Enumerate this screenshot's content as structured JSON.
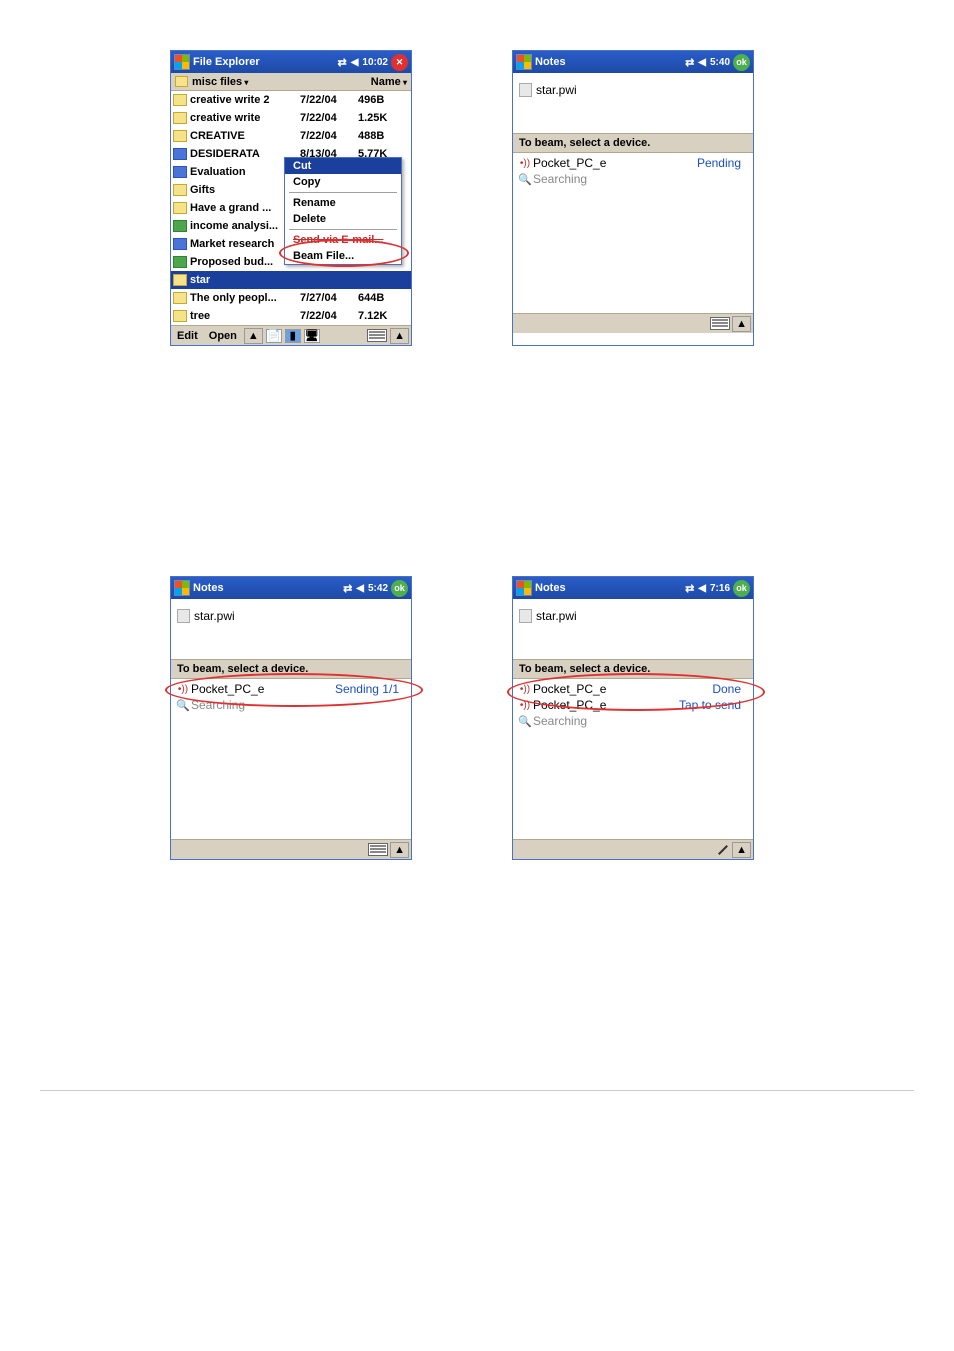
{
  "s1": {
    "title": "File Explorer",
    "time": "10:02",
    "subbar": {
      "folder": "misc files",
      "sort": "Name"
    },
    "files": [
      {
        "icon": "folder",
        "name": "creative write 2",
        "date": "7/22/04",
        "size": "496B"
      },
      {
        "icon": "folder",
        "name": "creative write",
        "date": "7/22/04",
        "size": "1.25K"
      },
      {
        "icon": "folder",
        "name": "CREATIVE",
        "date": "7/22/04",
        "size": "488B"
      },
      {
        "icon": "wd",
        "name": "DESIDERATA",
        "date": "8/13/04",
        "size": "5.77K"
      },
      {
        "icon": "wd",
        "name": "Evaluation",
        "date": "",
        "size": ""
      },
      {
        "icon": "folder",
        "name": "Gifts",
        "date": "",
        "size": ""
      },
      {
        "icon": "folder",
        "name": "Have a grand ...",
        "date": "",
        "size": ""
      },
      {
        "icon": "xl",
        "name": "income analysi...",
        "date": "",
        "size": ""
      },
      {
        "icon": "wd",
        "name": "Market research",
        "date": "",
        "size": ""
      },
      {
        "icon": "xl",
        "name": "Proposed bud...",
        "date": "",
        "size": ""
      },
      {
        "icon": "folder",
        "name": "star",
        "date": "",
        "size": "",
        "sel": true
      },
      {
        "icon": "folder",
        "name": "The only peopl...",
        "date": "7/27/04",
        "size": "644B"
      },
      {
        "icon": "folder",
        "name": "tree",
        "date": "7/22/04",
        "size": "7.12K"
      }
    ],
    "ctx": {
      "items": [
        "Cut",
        "Copy",
        "Rename",
        "Delete",
        "Send via E-mail...",
        "Beam File..."
      ],
      "hl": 0
    },
    "bottom": {
      "edit": "Edit",
      "open": "Open"
    }
  },
  "s2": {
    "title": "Notes",
    "time": "5:40",
    "file": "star.pwi",
    "instr": "To beam, select a device.",
    "devs": [
      {
        "icon": "ir",
        "name": "Pocket_PC_e",
        "status": "Pending"
      },
      {
        "icon": "mag",
        "name": "Searching",
        "status": ""
      }
    ]
  },
  "s3": {
    "title": "Notes",
    "time": "5:42",
    "file": "star.pwi",
    "instr": "To beam, select a device.",
    "devs": [
      {
        "icon": "ir",
        "name": "Pocket_PC_e",
        "status": "Sending 1/1"
      },
      {
        "icon": "mag",
        "name": "Searching",
        "status": ""
      }
    ]
  },
  "s4": {
    "title": "Notes",
    "time": "7:16",
    "file": "star.pwi",
    "instr": "To beam, select a device.",
    "devs": [
      {
        "icon": "ir",
        "name": "Pocket_PC_e",
        "status": "Done"
      },
      {
        "icon": "ir",
        "name": "Pocket_PC_e",
        "status": "Tap to send"
      },
      {
        "icon": "mag",
        "name": "Searching",
        "status": ""
      }
    ]
  },
  "labels": {
    "ok": "ok",
    "close": "✕",
    "up": "▲"
  }
}
